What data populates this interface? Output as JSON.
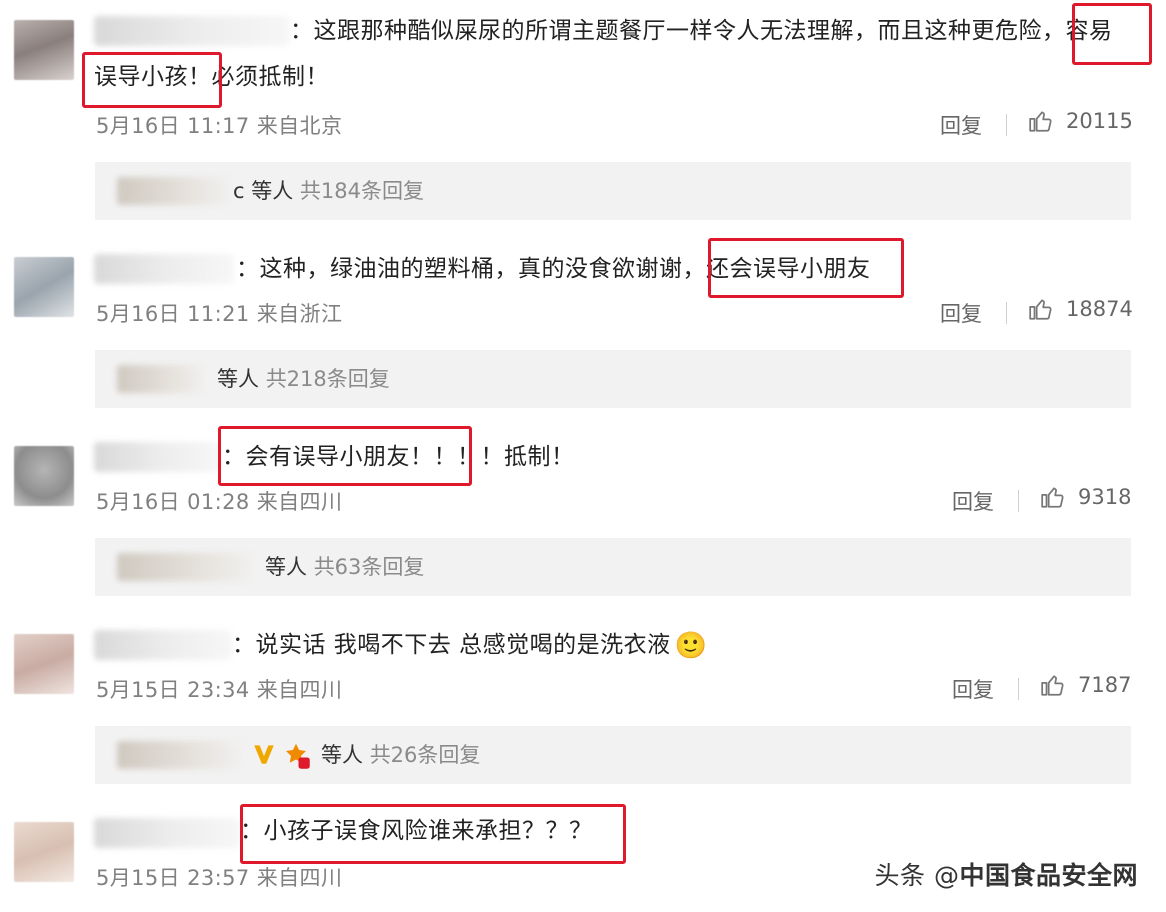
{
  "comments": [
    {
      "text": "：这跟那种酷似屎尿的所谓主题餐厅一样令人无法理解，而且这种更危险，容易",
      "text_line2": "误导小孩！必须抵制！",
      "meta": "5月16日 11:17 来自北京",
      "reply_label": "回复",
      "likes": "20115",
      "replies_tail": "c 等人",
      "replies_count": "共184条回复"
    },
    {
      "text": "：这种，绿油油的塑料桶，真的没食欲谢谢，还会误导小朋友",
      "meta": "5月16日 11:21 来自浙江",
      "reply_label": "回复",
      "likes": "18874",
      "replies_tail": "等人",
      "replies_count": "共218条回复"
    },
    {
      "text": "：会有误导小朋友！！！！抵制！",
      "meta": "5月16日 01:28 来自四川",
      "reply_label": "回复",
      "likes": "9318",
      "replies_tail": "等人",
      "replies_count": "共63条回复"
    },
    {
      "text": "：说实话 我喝不下去 总感觉喝的是洗衣液",
      "emoji": "🙂",
      "meta": "5月15日 23:34 来自四川",
      "reply_label": "回复",
      "likes": "7187",
      "replies_tail": "等人",
      "replies_count": "共26条回复"
    },
    {
      "text": "：小孩子误食风险谁来承担？？？",
      "meta": "5月15日 23:57 来自四川"
    }
  ],
  "watermark": {
    "prefix": "头条 @",
    "name": "中国食品安全网"
  },
  "colors": {
    "highlight": "#e0182b",
    "meta_gray": "#808080",
    "reply_box_bg": "#f2f2f2"
  }
}
